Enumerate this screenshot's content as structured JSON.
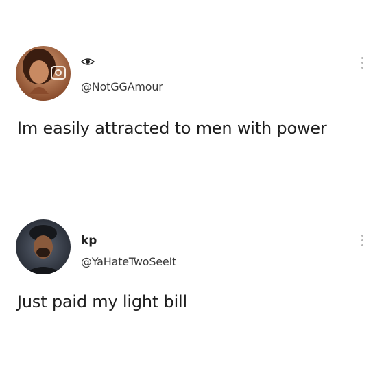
{
  "posts": [
    {
      "name": "",
      "handle": "@NotGGAmour",
      "text": "Im easily attracted to men with power",
      "name_icon": "eye-icon",
      "avatar_badge_icon": "camera-icon"
    },
    {
      "name": "kp",
      "handle": "@YaHateTwoSeeIt",
      "text": "Just paid my light bill"
    }
  ],
  "icons": {
    "more": "vertical-dots-icon"
  },
  "colors": {
    "text": "#1f1f1f",
    "handle": "#3a3a3a",
    "more_dots": "#b5b5b5",
    "background": "#ffffff"
  }
}
